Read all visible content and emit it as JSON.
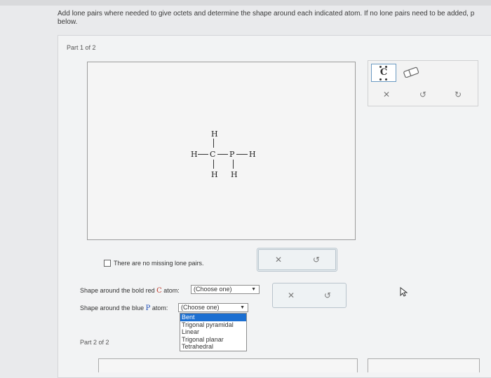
{
  "instructions": {
    "line1": "Add lone pairs where needed to give octets and determine the shape around each indicated atom. If no lone pairs need to be added, p",
    "line2": "below."
  },
  "part1": {
    "label": "Part 1 of 2"
  },
  "part2": {
    "label": "Part 2 of 2"
  },
  "molecule": {
    "atoms": {
      "h_top": "H",
      "h_left": "H",
      "c": "C",
      "p": "P",
      "h_right": "H",
      "h_bottom_c": "H",
      "h_bottom_p": "H"
    }
  },
  "toolbox": {
    "atom_tool": "C",
    "icons": [
      "eraser-icon",
      "close-icon",
      "undo-icon",
      "redo-icon"
    ]
  },
  "checkbox": {
    "label": "There are no missing lone pairs."
  },
  "shape_c": {
    "label_prefix": "Shape around the bold red ",
    "atom": "C",
    "label_suffix": " atom:",
    "value": "(Choose one)"
  },
  "shape_p": {
    "label_prefix": "Shape around the blue ",
    "atom": "P",
    "label_suffix": " atom:",
    "value": "(Choose one)"
  },
  "dropdown": {
    "options": [
      "Bent",
      "Trigonal pyramidal",
      "Linear",
      "Trigonal planar",
      "Tetrahedral"
    ],
    "highlighted": "Bent"
  },
  "colors": {
    "accent": "#1c6fd1",
    "c_atom": "#c0392b",
    "p_atom": "#1f4fb8"
  }
}
